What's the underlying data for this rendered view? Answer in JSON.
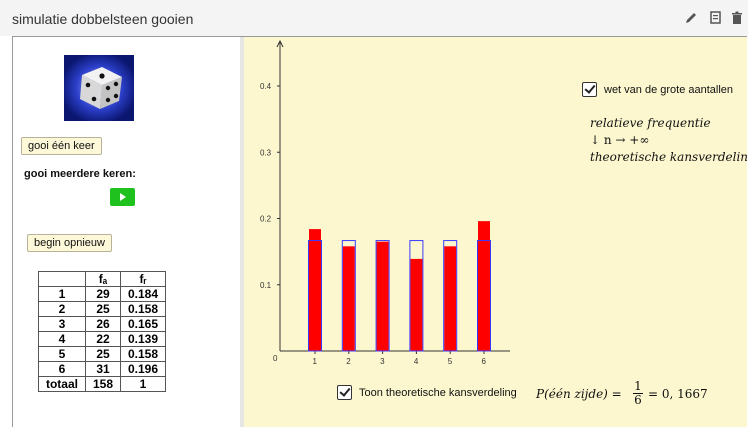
{
  "window": {
    "title": "simulatie dobbelsteen gooien",
    "icons": [
      "pencil-icon",
      "copy-icon",
      "trash-icon"
    ]
  },
  "left": {
    "throw_once_label": "gooi één keer",
    "throw_many_label": "gooi meerdere keren:",
    "reset_label": "begin opnieuw",
    "table": {
      "headers": [
        "",
        "fₐ",
        "fᵣ"
      ],
      "rows": [
        [
          "1",
          "29",
          "0.184"
        ],
        [
          "2",
          "25",
          "0.158"
        ],
        [
          "3",
          "26",
          "0.165"
        ],
        [
          "4",
          "22",
          "0.139"
        ],
        [
          "5",
          "25",
          "0.158"
        ],
        [
          "6",
          "31",
          "0.196"
        ],
        [
          "totaal",
          "158",
          "1"
        ]
      ]
    }
  },
  "right": {
    "law_checkbox_label": "wet van de grote aantallen",
    "legend_line1": "relatieve frequentie",
    "legend_line2": "↓  n → +∞",
    "legend_line3": "theoretische kansverdeling",
    "theory_checkbox_label": "Toon theoretische kansverdeling",
    "formula": "P(één zijde) = 1/6 = 0,1667",
    "formula_lhs": "P(één zijde) =",
    "formula_num": "1",
    "formula_den": "6",
    "formula_rhs": "= 0, 1667"
  },
  "colors": {
    "bar_fill": "#ff0000",
    "theory_outline": "#3a3aff",
    "panel_bg": "#fcf7cf",
    "play_button": "#1fc11f"
  },
  "chart_data": {
    "type": "bar",
    "categories": [
      "1",
      "2",
      "3",
      "4",
      "5",
      "6"
    ],
    "series": [
      {
        "values": [
          0.184,
          0.158,
          0.165,
          0.139,
          0.158,
          0.196
        ]
      },
      {
        "values": [
          0.1667,
          0.1667,
          0.1667,
          0.1667,
          0.1667,
          0.1667
        ]
      }
    ],
    "yticks": [
      "0",
      "0.1",
      "0.2",
      "0.3",
      "0.4"
    ],
    "ylim": [
      0,
      0.48
    ],
    "title": "",
    "xlabel": "",
    "ylabel": ""
  }
}
